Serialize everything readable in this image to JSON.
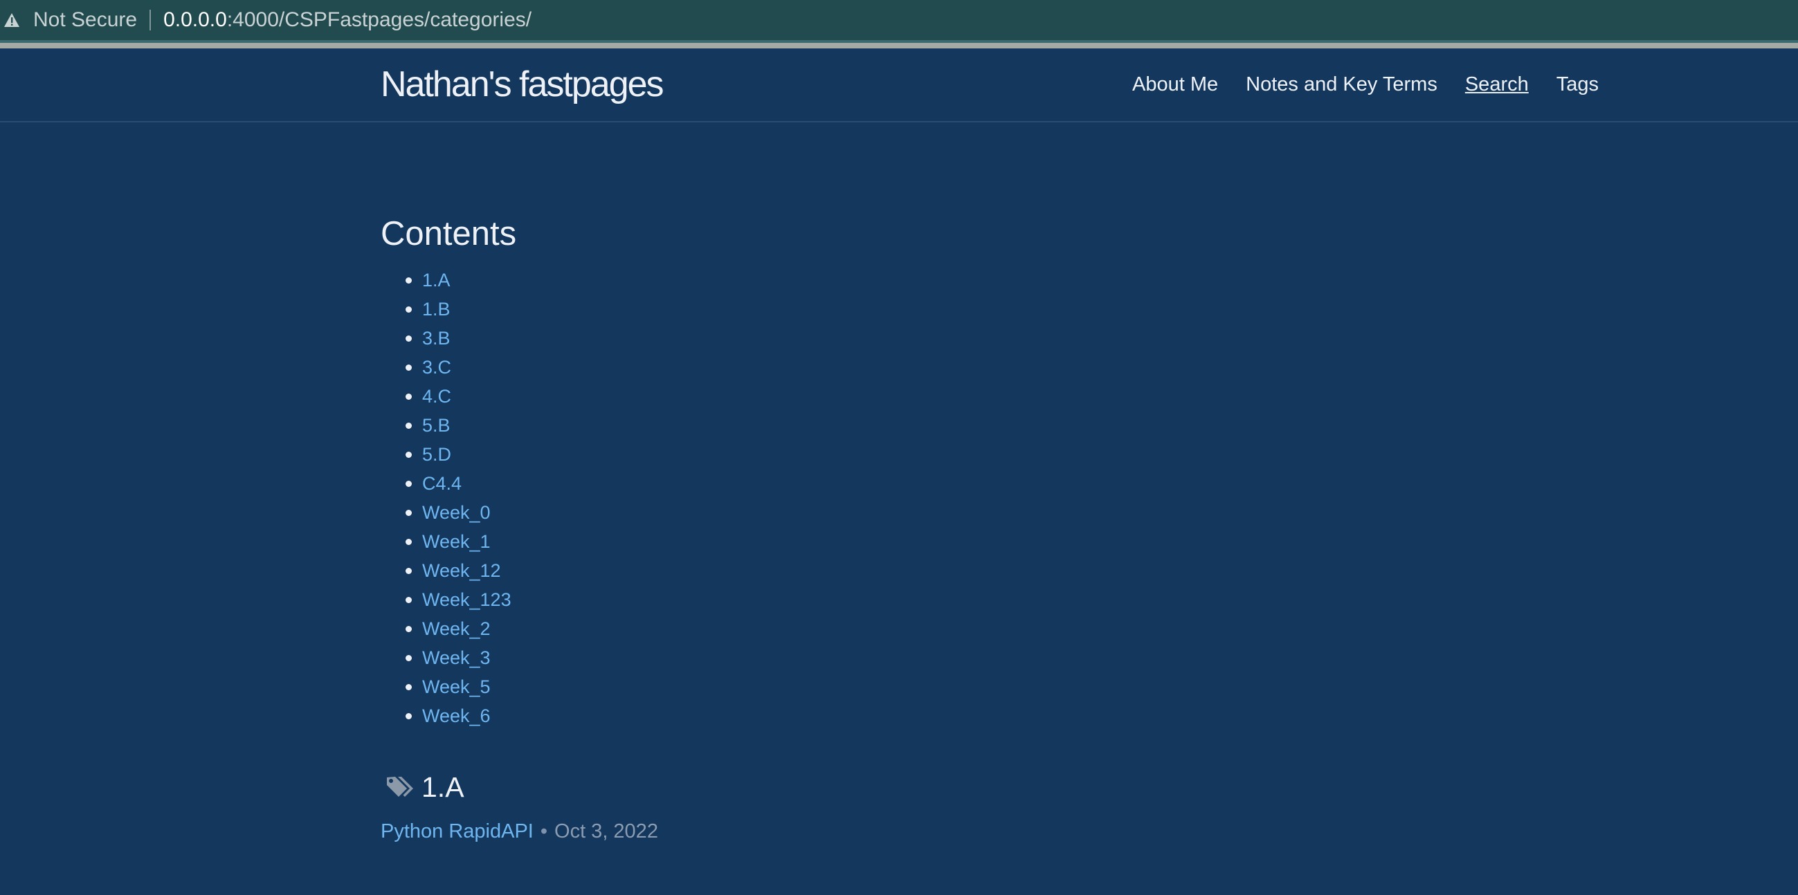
{
  "browser": {
    "security_label": "Not Secure",
    "url_host": "0.0.0.0",
    "url_rest": ":4000/CSPFastpages/categories/"
  },
  "header": {
    "site_title": "Nathan's fastpages",
    "nav": [
      {
        "label": "About Me"
      },
      {
        "label": "Notes and Key Terms"
      },
      {
        "label": "Search"
      },
      {
        "label": "Tags"
      }
    ]
  },
  "main": {
    "contents_heading": "Contents",
    "toc": [
      {
        "label": "1.A"
      },
      {
        "label": "1.B"
      },
      {
        "label": "3.B"
      },
      {
        "label": "3.C"
      },
      {
        "label": "4.C"
      },
      {
        "label": "5.B"
      },
      {
        "label": "5.D"
      },
      {
        "label": "C4.4"
      },
      {
        "label": "Week_0"
      },
      {
        "label": "Week_1"
      },
      {
        "label": "Week_12"
      },
      {
        "label": "Week_123"
      },
      {
        "label": "Week_2"
      },
      {
        "label": "Week_3"
      },
      {
        "label": "Week_5"
      },
      {
        "label": "Week_6"
      }
    ],
    "category": {
      "icon": "tags-icon",
      "title": "1.A",
      "posts": [
        {
          "title": "Python RapidAPI",
          "separator": "•",
          "date": "Oct 3, 2022"
        }
      ]
    }
  },
  "colors": {
    "page_background": "#14375e",
    "link": "#6fb6f0",
    "address_bar": "#224b4f"
  }
}
